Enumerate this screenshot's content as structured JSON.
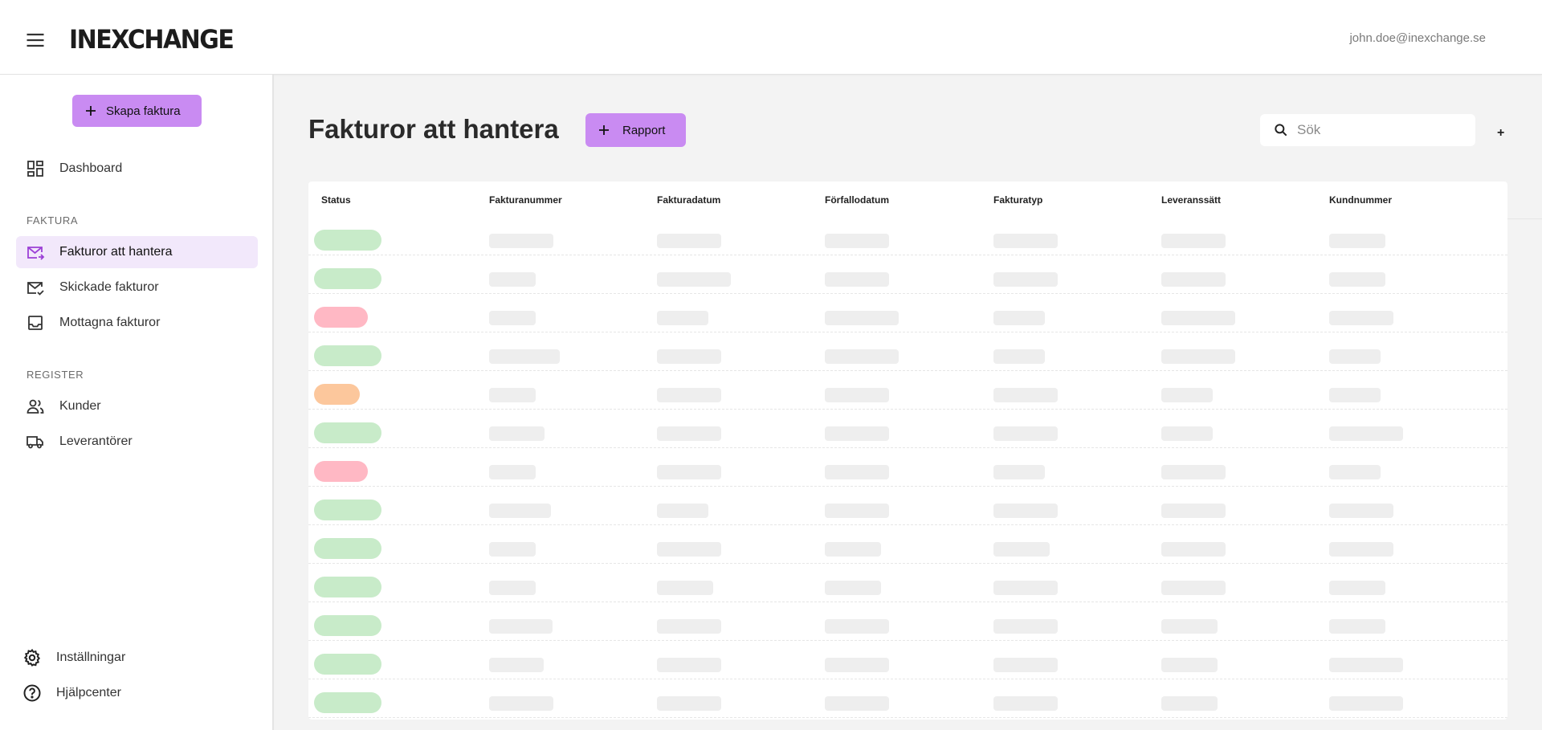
{
  "header": {
    "logo": "INEXCHANGE",
    "user_email": "john.doe@inexchange.se"
  },
  "sidebar": {
    "create_button": "Skapa faktura",
    "dashboard": "Dashboard",
    "section_faktura": "FAKTURA",
    "faktura_items": [
      {
        "label": "Fakturor att hantera",
        "icon": "mail-forward-icon",
        "active": true
      },
      {
        "label": "Skickade fakturor",
        "icon": "mail-check-icon",
        "active": false
      },
      {
        "label": "Mottagna fakturor",
        "icon": "inbox-icon",
        "active": false
      }
    ],
    "section_register": "REGISTER",
    "register_items": [
      {
        "label": "Kunder",
        "icon": "people-icon"
      },
      {
        "label": "Leverantörer",
        "icon": "truck-icon"
      }
    ],
    "settings": "Inställningar",
    "help": "Hjälpcenter"
  },
  "main": {
    "title": "Fakturor att hantera",
    "report_button": "Rapport",
    "search_placeholder": "Sök",
    "add_symbol": "+"
  },
  "table": {
    "columns": [
      "Status",
      "Fakturanummer",
      "Fakturadatum",
      "Förfallodatum",
      "Fakturatyp",
      "Leveranssätt",
      "Kundnummer"
    ],
    "loading": true,
    "row_statuses": [
      "green",
      "green",
      "red",
      "green",
      "orange",
      "green",
      "red",
      "green",
      "green",
      "green",
      "green",
      "green",
      "green"
    ]
  },
  "colors": {
    "accent": "#c98bf2",
    "active_nav_bg": "#f2e8fb",
    "status_green": "#c8ebc9",
    "status_red": "#ffb8c4",
    "status_orange": "#fcc79c",
    "skeleton": "#eeeeee"
  }
}
